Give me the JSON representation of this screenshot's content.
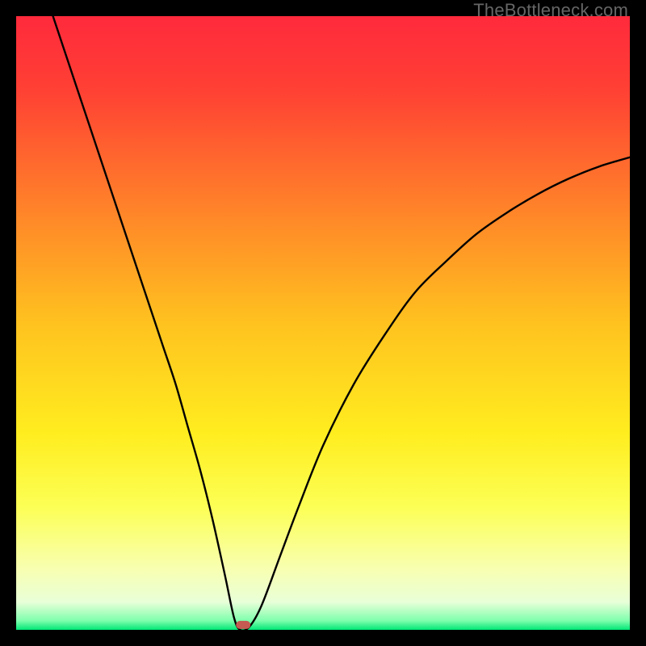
{
  "watermark": "TheBottleneck.com",
  "chart_data": {
    "type": "line",
    "title": "",
    "xlabel": "",
    "ylabel": "",
    "xlim": [
      0,
      100
    ],
    "ylim": [
      0,
      100
    ],
    "background_gradient": {
      "stops": [
        {
          "offset": 0.0,
          "color": "#ff2a3c"
        },
        {
          "offset": 0.12,
          "color": "#ff4034"
        },
        {
          "offset": 0.3,
          "color": "#ff7e2a"
        },
        {
          "offset": 0.5,
          "color": "#ffc21f"
        },
        {
          "offset": 0.68,
          "color": "#ffed1f"
        },
        {
          "offset": 0.8,
          "color": "#fcff55"
        },
        {
          "offset": 0.9,
          "color": "#f8ffb0"
        },
        {
          "offset": 0.955,
          "color": "#e8ffd8"
        },
        {
          "offset": 0.985,
          "color": "#7fffad"
        },
        {
          "offset": 1.0,
          "color": "#00e676"
        }
      ]
    },
    "series": [
      {
        "name": "bottleneck-curve",
        "color": "#000000",
        "x": [
          6,
          8,
          10,
          12,
          14,
          16,
          18,
          20,
          22,
          24,
          26,
          28,
          30,
          32,
          34,
          35.5,
          36.5,
          38,
          40,
          43,
          46,
          50,
          55,
          60,
          65,
          70,
          75,
          80,
          85,
          90,
          95,
          100
        ],
        "y": [
          100,
          94,
          88,
          82,
          76,
          70,
          64,
          58,
          52,
          46,
          40,
          33,
          26,
          18,
          9,
          2,
          0,
          0.5,
          4,
          12,
          20,
          30,
          40,
          48,
          55,
          60,
          64.5,
          68,
          71,
          73.5,
          75.5,
          77
        ]
      }
    ],
    "marker": {
      "name": "minimum-point",
      "x": 37,
      "y": 0.8,
      "color": "#c45a52"
    }
  }
}
